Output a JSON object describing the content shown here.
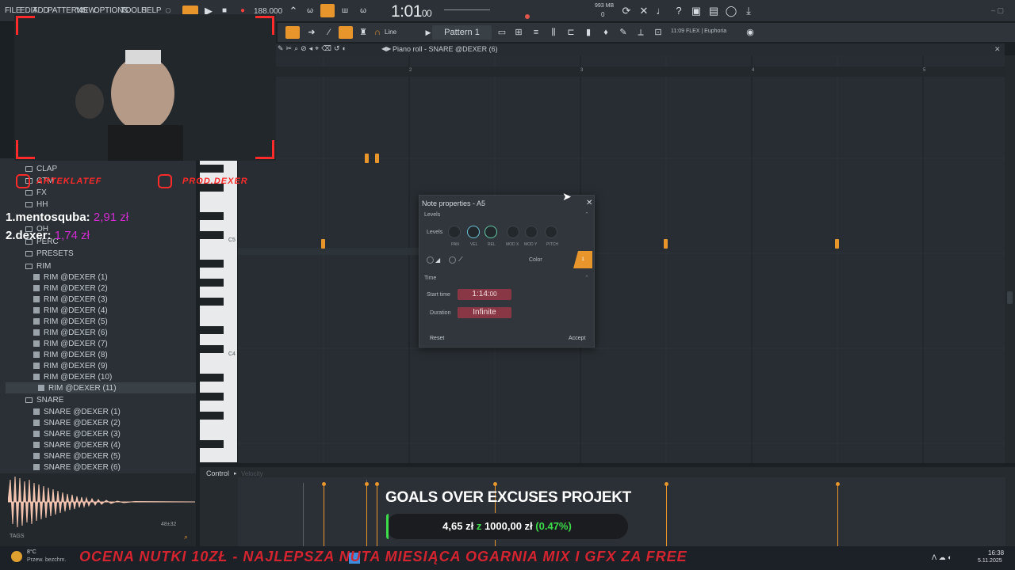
{
  "menu": [
    "FILE",
    "EDIT",
    "ADD",
    "PATTERNS",
    "VIEW",
    "OPTIONS",
    "TOOLS",
    "HELP"
  ],
  "transport": {
    "tempo": "188.000",
    "song_time": "1:01",
    "song_time_small": "00",
    "memory": "993 MB",
    "cpu": "0"
  },
  "toolbar2": {
    "snap": "Line",
    "pattern": "Pattern 1",
    "hint": "11:09 FLEX | Euphoria"
  },
  "piano_roll": {
    "title": "Piano roll - SNARE @DEXER (6)",
    "ruler": [
      "2",
      "3",
      "4",
      "5"
    ],
    "key_labels": [
      "C5",
      "C4"
    ]
  },
  "browser": {
    "folders": [
      "CLAP",
      "CTM",
      "FX",
      "HH",
      "OH",
      "PERC",
      "PRESETS",
      "RIM"
    ],
    "rim_items": [
      "RIM @DEXER (1)",
      "RIM @DEXER (2)",
      "RIM @DEXER (3)",
      "RIM @DEXER (4)",
      "RIM @DEXER (5)",
      "RIM @DEXER (6)",
      "RIM @DEXER (7)",
      "RIM @DEXER (8)",
      "RIM @DEXER (9)",
      "RIM @DEXER (10)",
      "RIM @DEXER (11)"
    ],
    "snare_folder": "SNARE",
    "snare_items": [
      "SNARE @DEXER (1)",
      "SNARE @DEXER (2)",
      "SNARE @DEXER (3)",
      "SNARE @DEXER (4)",
      "SNARE @DEXER (5)",
      "SNARE @DEXER (6)"
    ],
    "tags_label": "TAGS",
    "sample_info": "48±32"
  },
  "donors": [
    {
      "name": "1.mentosquba:",
      "amount": "2,91 zł"
    },
    {
      "name": "2.dexer:",
      "amount": "1,74 zł"
    }
  ],
  "instagram": {
    "handle1": "ARTEKLATEF",
    "handle2": "PROD.DEXER"
  },
  "dialog": {
    "title": "Note properties - A5",
    "section_levels": "Levels",
    "levels_label": "Levels",
    "knobs": [
      "PAN",
      "VEL",
      "REL",
      "MOD X",
      "MOD Y",
      "PITCH"
    ],
    "color_label": "Color",
    "color_value": "1",
    "section_time": "Time",
    "start_time_label": "Start time",
    "start_time_value": "1:14:",
    "start_time_small": "00",
    "duration_label": "Duration",
    "duration_value": "Infinite",
    "reset": "Reset",
    "accept": "Accept"
  },
  "control": {
    "label": "Control",
    "target": "Velocity"
  },
  "goal": {
    "title": "GOALS OVER EXCUSES PROJEKT",
    "current": "4,65 zł",
    "of": "z",
    "target": "1000,00 zł",
    "percent": "(0.47%)"
  },
  "taskbar": {
    "temp": "8°C",
    "weather": "Przew. bezchm.",
    "time": "16:38",
    "date": "5.11.2025"
  },
  "ticker": "OCENA NUTKI 10ZŁ - NAJLEPSZA NUTA MIESIĄCA OGARNIA MIX I GFX ZA FREE",
  "colors": {
    "note": "#e8952c",
    "accent_red": "#ff2a2a",
    "field": "#8a3745",
    "percent_green": "#3ddc4a"
  }
}
